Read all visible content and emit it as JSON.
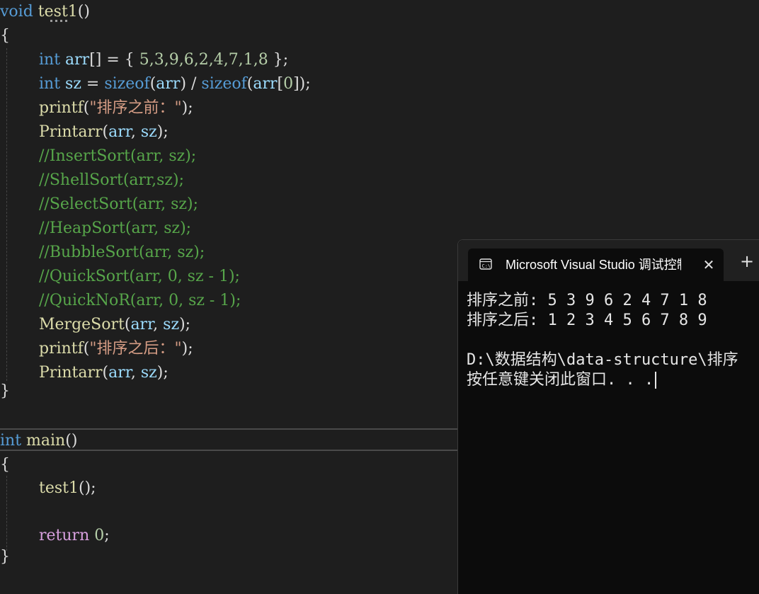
{
  "editor": {
    "lines": {
      "l1": {
        "void": "void",
        "name": "test1",
        "paren": "()"
      },
      "l2": {
        "brace": "{"
      },
      "l3": {
        "type": "int",
        "var": "arr",
        "rest": "[] = { ",
        "n": "5,3,9,6,2,4,7,1,8",
        "end": " };"
      },
      "l4": {
        "type": "int",
        "var": "sz",
        "eq": " = ",
        "f1": "sizeof",
        "p1": "(",
        "a1": "arr",
        "p2": ") / ",
        "f2": "sizeof",
        "p3": "(",
        "a2": "arr",
        "p4": "[",
        "n0": "0",
        "p5": "]);"
      },
      "l5": {
        "fn": "printf",
        "p1": "(",
        "str": "\"排序之前：\"",
        "p2": ");"
      },
      "l6": {
        "fn": "Printarr",
        "p1": "(",
        "a": "arr",
        "c": ", ",
        "b": "sz",
        "p2": ");"
      },
      "l7": "//InsertSort(arr, sz);",
      "l8": "//ShellSort(arr,sz);",
      "l9": "//SelectSort(arr, sz);",
      "l10": "//HeapSort(arr, sz);",
      "l11": "//BubbleSort(arr, sz);",
      "l12": "//QuickSort(arr, 0, sz - 1);",
      "l13": "//QuickNoR(arr, 0, sz - 1);",
      "l14": {
        "fn": "MergeSort",
        "p1": "(",
        "a": "arr",
        "c": ", ",
        "b": "sz",
        "p2": ");"
      },
      "l15": {
        "fn": "printf",
        "p1": "(",
        "str": "\"排序之后：\"",
        "p2": ");"
      },
      "l16": {
        "fn": "Printarr",
        "p1": "(",
        "a": "arr",
        "c": ", ",
        "b": "sz",
        "p2": ");"
      },
      "l17": {
        "brace": "}"
      },
      "l18": {
        "type": "int",
        "name": "main",
        "paren": "()"
      },
      "l19": {
        "brace": "{"
      },
      "l20": {
        "fn": "test1",
        "rest": "();"
      },
      "l21": {
        "kw": "return",
        "sp": " ",
        "n": "0",
        "end": ";"
      },
      "l22": {
        "brace": "}"
      }
    }
  },
  "terminal": {
    "tab_title": "Microsoft Visual Studio 调试控制台",
    "close_icon": "close-icon",
    "new_tab_icon": "plus-icon",
    "output": [
      "排序之前: 5 3 9 6 2 4 7 1 8",
      "排序之后: 1 2 3 4 5 6 7 8 9",
      "",
      "D:\\数据结构\\data-structure\\排序",
      "按任意键关闭此窗口. . ."
    ]
  },
  "colors": {
    "keyword": "#569cd6",
    "function": "#dcdcaa",
    "variable": "#9cdcfe",
    "number": "#b5cea8",
    "string": "#d69d85",
    "comment": "#57a64a",
    "editor_bg": "#1e1e1e",
    "terminal_bg": "#0c0c0c"
  }
}
